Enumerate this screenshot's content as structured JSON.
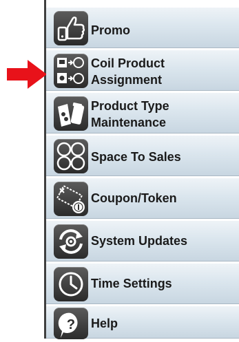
{
  "menu": {
    "items": [
      {
        "label": "Promo",
        "icon": "thumbs-up-icon"
      },
      {
        "label_line1": "Coil Product",
        "label_line2": "Assignment",
        "icon": "coil-assignment-icon"
      },
      {
        "label_line1": "Product Type",
        "label_line2": "Maintenance",
        "icon": "product-type-icon"
      },
      {
        "label": "Space To Sales",
        "icon": "space-to-sales-icon"
      },
      {
        "label": "Coupon/Token",
        "icon": "coupon-token-icon"
      },
      {
        "label": "System Updates",
        "icon": "system-updates-icon"
      },
      {
        "label": "Time Settings",
        "icon": "clock-icon"
      },
      {
        "label": "Help",
        "icon": "help-icon"
      }
    ]
  },
  "colors": {
    "arrow": "#e8121a",
    "icon_tile": "#3a3a3a",
    "item_gradient_top": "#eef3f7",
    "item_gradient_bottom": "#c8d6e1",
    "label_text": "#1a1a1a"
  }
}
